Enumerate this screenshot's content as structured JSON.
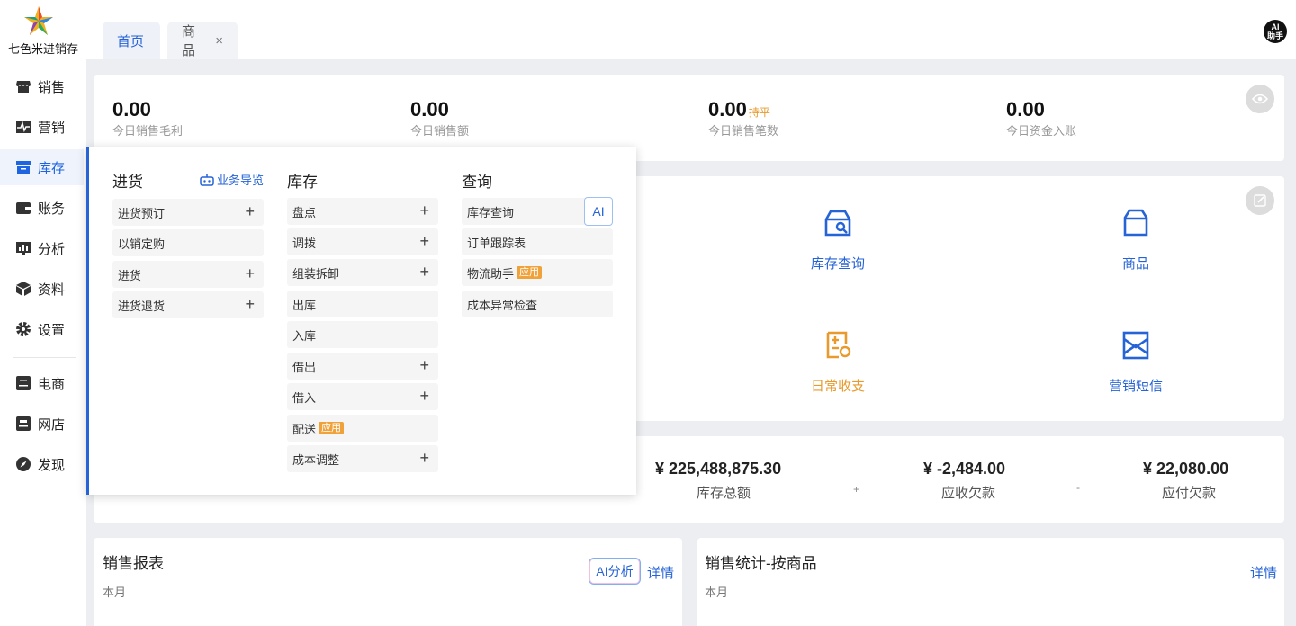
{
  "brand": {
    "name": "七色米进销存"
  },
  "sidebar": {
    "items": [
      {
        "label": "销售",
        "icon": "store-icon"
      },
      {
        "label": "营销",
        "icon": "pulse-icon"
      },
      {
        "label": "库存",
        "icon": "box-icon",
        "active": true
      },
      {
        "label": "账务",
        "icon": "wallet-icon"
      },
      {
        "label": "分析",
        "icon": "chart-icon"
      },
      {
        "label": "资料",
        "icon": "cube-icon"
      },
      {
        "label": "设置",
        "icon": "gear-icon"
      },
      {
        "label": "电商",
        "icon": "ecommerce-icon"
      },
      {
        "label": "网店",
        "icon": "webshop-icon"
      },
      {
        "label": "发现",
        "icon": "compass-icon"
      }
    ]
  },
  "tabs": [
    {
      "label": "首页",
      "active": true
    },
    {
      "label": "商品",
      "closable": true,
      "close": "×"
    }
  ],
  "ai_assistant": {
    "line1": "AI",
    "line2": "助手"
  },
  "stats": [
    {
      "value": "0.00",
      "label": "今日销售毛利"
    },
    {
      "value": "0.00",
      "label": "今日销售额"
    },
    {
      "value": "0.00",
      "label": "今日销售笔数",
      "badge": "持平"
    },
    {
      "value": "0.00",
      "label": "今日资金入账"
    }
  ],
  "quick_actions": [
    {
      "label": "库存查询",
      "icon": "stock-search-icon",
      "color": "#2563d6"
    },
    {
      "label": "商品",
      "icon": "goods-box-icon",
      "color": "#2563d6"
    },
    {
      "label": "日常收支",
      "icon": "ledger-icon",
      "color": "#e89a2c"
    },
    {
      "label": "营销短信",
      "icon": "sms-icon",
      "color": "#2563d6"
    }
  ],
  "money": [
    {
      "value": "¥ 225,488,875.30",
      "label": "库存总额"
    },
    {
      "value": "¥ -2,484.00",
      "label": "应收欠款"
    },
    {
      "value": "¥ 22,080.00",
      "label": "应付欠款"
    }
  ],
  "money_ops": [
    "+",
    "-"
  ],
  "panels": {
    "sales_report": {
      "title": "销售报表",
      "sub": "本月",
      "ai": "AI分析",
      "detail": "详情"
    },
    "sales_by_goods": {
      "title": "销售统计-按商品",
      "sub": "本月",
      "detail": "详情"
    }
  },
  "menu": {
    "purchase": {
      "title": "进货",
      "guide": "业务导览",
      "items": [
        {
          "label": "进货预订",
          "plus": "+"
        },
        {
          "label": "以销定购"
        },
        {
          "label": "进货",
          "plus": "+"
        },
        {
          "label": "进货退货",
          "plus": "+"
        }
      ]
    },
    "stock": {
      "title": "库存",
      "items": [
        {
          "label": "盘点",
          "plus": "+"
        },
        {
          "label": "调拨",
          "plus": "+"
        },
        {
          "label": "组装拆卸",
          "plus": "+"
        },
        {
          "label": "出库"
        },
        {
          "label": "入库"
        },
        {
          "label": "借出",
          "plus": "+"
        },
        {
          "label": "借入",
          "plus": "+"
        },
        {
          "label": "配送",
          "tag": "应用"
        },
        {
          "label": "成本调整",
          "plus": "+"
        }
      ]
    },
    "query": {
      "title": "查询",
      "items": [
        {
          "label": "库存查询",
          "ai": "AI"
        },
        {
          "label": "订单跟踪表"
        },
        {
          "label": "物流助手",
          "tag": "应用"
        },
        {
          "label": "成本异常检查"
        }
      ]
    }
  }
}
